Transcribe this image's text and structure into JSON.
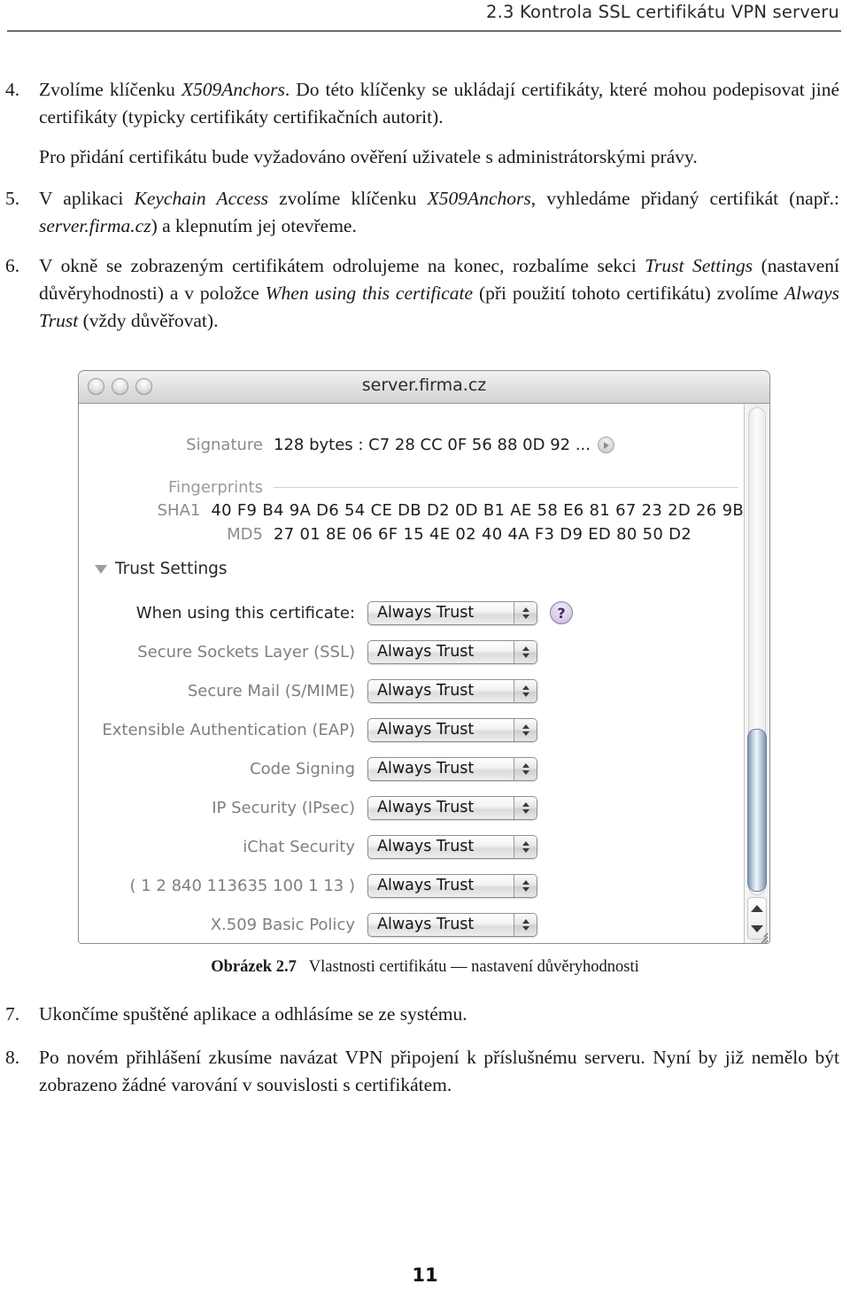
{
  "header": {
    "running_head": "2.3  Kontrola SSL certifikátu VPN serveru"
  },
  "steps": {
    "item4_num": "4.",
    "item4_text_a": "Zvolíme klíčenku ",
    "item4_em1": "X509Anchors",
    "item4_text_b": ". Do této klíčenky se ukládají certifikáty, které mohou podepisovat jiné certifikáty (typicky certifikáty certifikačních autorit).",
    "item4_para2": "Pro přidání certifikátu bude vyžadováno ověření uživatele s administrátorskými právy.",
    "item5_num": "5.",
    "item5_text_a": "V aplikaci ",
    "item5_em1": "Keychain Access",
    "item5_text_b": " zvolíme klíčenku ",
    "item5_em2": "X509Anchors",
    "item5_text_c": ", vyhledáme přidaný certifikát (např.: ",
    "item5_em3": "server.firma.cz",
    "item5_text_d": ") a klepnutím jej otevřeme.",
    "item6_num": "6.",
    "item6_text_a": "V okně se zobrazeným certifikátem odrolujeme na konec, rozbalíme sekci ",
    "item6_em1": "Trust Settings",
    "item6_text_b": " (nastavení důvěryhodnosti) a v položce ",
    "item6_em2": "When using this certificate",
    "item6_text_c": " (při použití tohoto certifikátu) zvolíme ",
    "item6_em3": "Always Trust",
    "item6_text_d": " (vždy důvěřovat).",
    "item7_num": "7.",
    "item7_text": "Ukončíme spuštěné aplikace a odhlásíme se ze systému.",
    "item8_num": "8.",
    "item8_text": "Po novém přihlášení zkusíme navázat VPN připojení k příslušnému serveru. Nyní by již nemělo být zobrazeno žádné varování v souvislosti s certifikátem."
  },
  "figure": {
    "window_title": "server.firma.cz",
    "signature": {
      "label": "Signature",
      "value": "128 bytes : C7 28 CC 0F 56 88 0D 92 ..."
    },
    "fingerprints": {
      "group_label": "Fingerprints",
      "rows": [
        {
          "label": "SHA1",
          "value": "40 F9 B4 9A D6 54 CE DB D2 0D B1 AE 58 E6 81 67 23 2D 26 9B"
        },
        {
          "label": "MD5",
          "value": "27 01 8E 06 6F 15 4E 02 40 4A F3 D9 ED 80 50 D2"
        }
      ]
    },
    "trust_settings": {
      "section_label": "Trust Settings",
      "help_label": "?",
      "rows": [
        {
          "label": "When using this certificate:",
          "value": "Always Trust"
        },
        {
          "label": "Secure Sockets Layer (SSL)",
          "value": "Always Trust"
        },
        {
          "label": "Secure Mail (S/MIME)",
          "value": "Always Trust"
        },
        {
          "label": "Extensible Authentication (EAP)",
          "value": "Always Trust"
        },
        {
          "label": "Code Signing",
          "value": "Always Trust"
        },
        {
          "label": "IP Security (IPsec)",
          "value": "Always Trust"
        },
        {
          "label": "iChat Security",
          "value": "Always Trust"
        },
        {
          "label": "( 1 2 840 113635 100 1 13 )",
          "value": "Always Trust"
        },
        {
          "label": "X.509 Basic Policy",
          "value": "Always Trust"
        }
      ]
    }
  },
  "caption": {
    "number": "Obrázek 2.7",
    "text": "Vlastnosti certifikátu — nastavení důvěryhodnosti"
  },
  "footer": {
    "page_number": "11"
  },
  "colors": {
    "help_button": "#c3b2dc",
    "scroll_thumb": "#8ea7c0",
    "label_gray": "#7f7f7f",
    "rule_gray": "#6d6d6d"
  }
}
